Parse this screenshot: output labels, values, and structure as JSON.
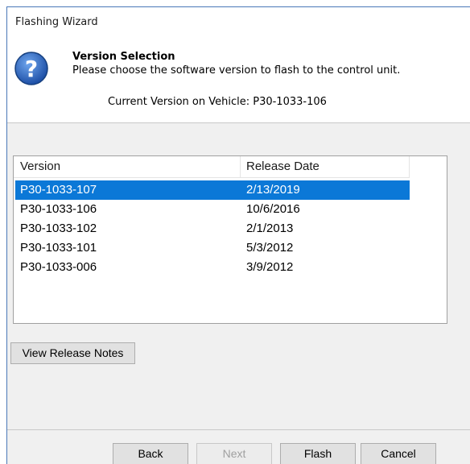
{
  "window": {
    "title": "Flashing Wizard"
  },
  "header": {
    "icon": "question-help-icon",
    "title": "Version Selection",
    "description": "Please choose the software version to flash to the control unit.",
    "current_version_label": "Current Version on Vehicle:",
    "current_version_value": "P30-1033-106"
  },
  "versions_table": {
    "columns": [
      "Version",
      "Release Date"
    ],
    "selected_index": 0,
    "rows": [
      {
        "version": "P30-1033-107",
        "release_date": "2/13/2019"
      },
      {
        "version": "P30-1033-106",
        "release_date": "10/6/2016"
      },
      {
        "version": "P30-1033-102",
        "release_date": "2/1/2013"
      },
      {
        "version": "P30-1033-101",
        "release_date": "5/3/2012"
      },
      {
        "version": "P30-1033-006",
        "release_date": "3/9/2012"
      }
    ]
  },
  "actions": {
    "view_release_notes": "View Release Notes"
  },
  "footer": {
    "back": "Back",
    "next": "Next",
    "next_enabled": false,
    "flash": "Flash",
    "cancel": "Cancel"
  },
  "colors": {
    "selection": "#0b78d7",
    "window_border": "#4a78b8",
    "icon_blue": "#2a5fb8"
  }
}
